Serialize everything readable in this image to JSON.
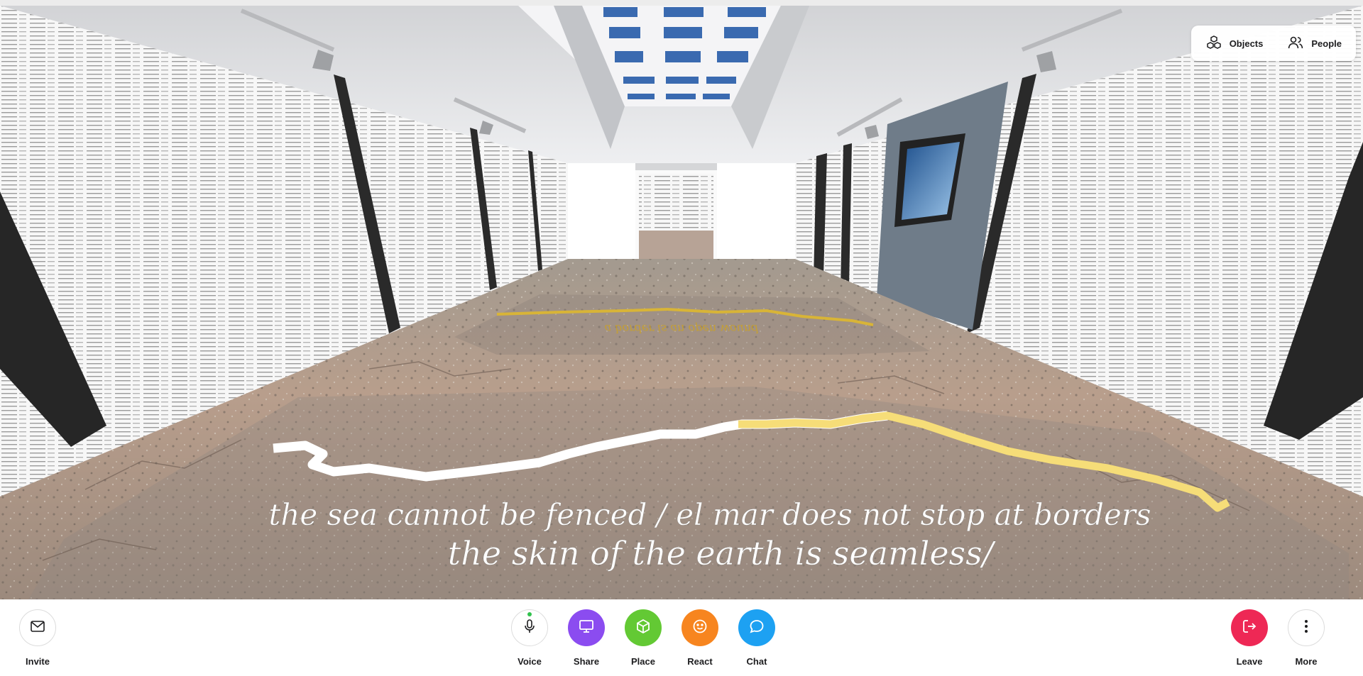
{
  "scene": {
    "floor_text_line1": "the sea cannot be fenced / el mar does not stop at borders",
    "floor_text_line2": "the skin of the earth is seamless/",
    "far_floor_text": "a border is an open wound"
  },
  "top_panel": {
    "objects_label": "Objects",
    "people_label": "People"
  },
  "toolbar": {
    "invite": {
      "label": "Invite",
      "icon": "mail-icon"
    },
    "voice": {
      "label": "Voice",
      "icon": "microphone-icon",
      "status_color": "#31c24d"
    },
    "share": {
      "label": "Share",
      "icon": "monitor-icon",
      "color": "#8b4cf0"
    },
    "place": {
      "label": "Place",
      "icon": "cube-icon",
      "color": "#63c934"
    },
    "react": {
      "label": "React",
      "icon": "smiley-icon",
      "color": "#f7851f"
    },
    "chat": {
      "label": "Chat",
      "icon": "chat-bubble-icon",
      "color": "#1da1f2"
    },
    "leave": {
      "label": "Leave",
      "icon": "exit-icon",
      "color": "#ee2855"
    },
    "more": {
      "label": "More",
      "icon": "more-vertical-icon"
    }
  }
}
